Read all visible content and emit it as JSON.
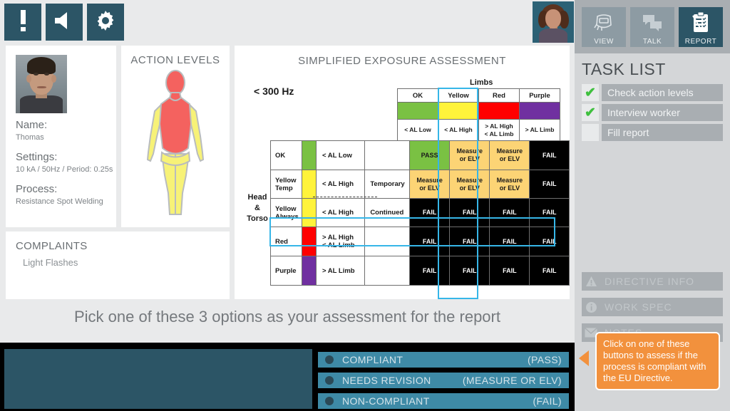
{
  "toolbar": {
    "alert_icon": "exclamation-icon",
    "sound_icon": "speaker-icon",
    "settings_icon": "gear-icon"
  },
  "worker": {
    "name_key": "Name:",
    "name_value": "Thomas",
    "settings_key": "Settings:",
    "settings_value": "10 kA / 50Hz / Period: 0.25s",
    "process_key": "Process:",
    "process_value": "Resistance Spot Welding"
  },
  "action_levels": {
    "title": "ACTION LEVELS",
    "torso_color": "#f4625f",
    "limb_color": "#f7f277"
  },
  "complaints": {
    "title": "COMPLAINTS",
    "items": [
      "Light Flashes"
    ]
  },
  "assessment": {
    "title": "SIMPLIFIED EXPOSURE ASSESSMENT",
    "frequency": "< 300 Hz",
    "limbs_label": "Limbs",
    "head_torso_label": "Head\n&\nTorso"
  },
  "chart_data": {
    "type": "table",
    "title": "SIMPLIFIED EXPOSURE ASSESSMENT",
    "subtitle": "< 300 Hz",
    "xlabel": "Limbs",
    "ylabel": "Head & Torso",
    "columns": [
      {
        "name": "OK",
        "color": "#7ac143",
        "condition": "< AL Low"
      },
      {
        "name": "Yellow",
        "color": "#fff33b",
        "condition": "< AL High"
      },
      {
        "name": "Red",
        "color": "#ff0000",
        "condition": "> AL High\n< AL Limb"
      },
      {
        "name": "Purple",
        "color": "#7030a0",
        "condition": "> AL Limb"
      }
    ],
    "rows": [
      {
        "name": "OK",
        "color": "#7ac143",
        "condition": "< AL Low",
        "duration": ""
      },
      {
        "name": "Yellow\nTemp",
        "color": "#fff33b",
        "condition": "< AL High",
        "duration": "Temporary"
      },
      {
        "name": "Yellow\nAlways",
        "color": "#fff33b",
        "condition": "< AL High",
        "duration": "Continued"
      },
      {
        "name": "Red",
        "color": "#ff0000",
        "condition": "> AL High\n< AL Limb",
        "duration": ""
      },
      {
        "name": "Purple",
        "color": "#7030a0",
        "condition": "> AL Limb",
        "duration": ""
      }
    ],
    "matrix": [
      [
        "PASS",
        "Measure\nor ELV",
        "Measure\nor ELV",
        "FAIL"
      ],
      [
        "Measure\nor ELV",
        "Measure\nor ELV",
        "Measure\nor ELV",
        "FAIL"
      ],
      [
        "FAIL",
        "FAIL",
        "FAIL",
        "FAIL"
      ],
      [
        "FAIL",
        "FAIL",
        "FAIL",
        "FAIL"
      ],
      [
        "FAIL",
        "FAIL",
        "FAIL",
        "FAIL"
      ]
    ],
    "cell_colors": {
      "PASS": "#7ac143",
      "Measure or ELV": "#fcd475",
      "FAIL": "#000000"
    },
    "highlighted_column": "Yellow",
    "highlighted_row": "Red",
    "highlight_color": "#36b6e8"
  },
  "instruction": "Pick one of these 3 options as your assessment for the report",
  "options": [
    {
      "label": "COMPLIANT",
      "note": "(PASS)"
    },
    {
      "label": "NEEDS REVISION",
      "note": "(MEASURE OR ELV)"
    },
    {
      "label": "NON-COMPLIANT",
      "note": "(FAIL)"
    }
  ],
  "sidebar": {
    "modes": [
      {
        "label": "VIEW",
        "icon": "welding-helmet-icon",
        "active": false
      },
      {
        "label": "TALK",
        "icon": "speech-bubbles-icon",
        "active": false
      },
      {
        "label": "REPORT",
        "icon": "clipboard-icon",
        "active": true
      }
    ],
    "task_list_title": "TASK LIST",
    "tasks": [
      {
        "label": "Check action levels",
        "done": true,
        "check": "✔"
      },
      {
        "label": "Interview worker",
        "done": true,
        "check": "✔"
      },
      {
        "label": "Fill report",
        "done": false,
        "check": ""
      }
    ],
    "info_buttons": [
      {
        "label": "DIRECTIVE INFO",
        "icon": "warning-icon"
      },
      {
        "label": "WORK SPEC",
        "icon": "info-icon"
      },
      {
        "label": "NOTES",
        "icon": "envelope-icon"
      }
    ]
  },
  "tooltip": {
    "text": "Click on one of these buttons to assess if the process is compliant with the EU Directive."
  }
}
